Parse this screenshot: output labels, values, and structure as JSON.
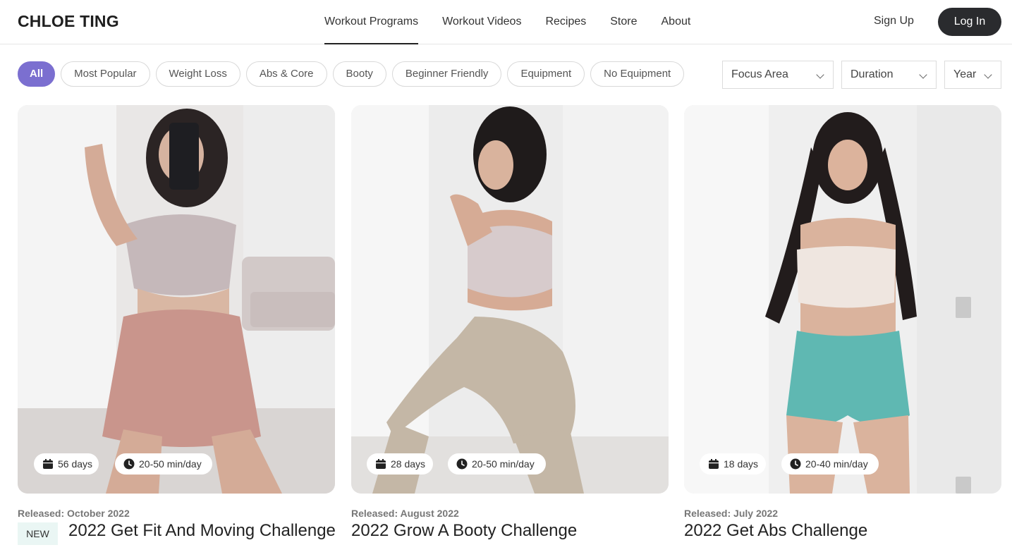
{
  "header": {
    "logo": "CHLOE TING",
    "nav": [
      {
        "label": "Workout Programs",
        "active": true
      },
      {
        "label": "Workout Videos",
        "active": false
      },
      {
        "label": "Recipes",
        "active": false
      },
      {
        "label": "Store",
        "active": false
      },
      {
        "label": "About",
        "active": false
      }
    ],
    "signup_label": "Sign Up",
    "login_label": "Log In"
  },
  "filters": {
    "pills": [
      "All",
      "Most Popular",
      "Weight Loss",
      "Abs & Core",
      "Booty",
      "Beginner Friendly",
      "Equipment",
      "No Equipment"
    ],
    "active_pill": "All",
    "dropdowns": [
      "Focus Area",
      "Duration",
      "Year"
    ]
  },
  "cards": [
    {
      "days": "56 days",
      "duration": "20-50 min/day",
      "released": "Released: October 2022",
      "new_tag": "NEW",
      "title": "2022 Get Fit And Moving Challenge"
    },
    {
      "days": "28 days",
      "duration": "20-50 min/day",
      "released": "Released: August 2022",
      "title": "2022 Grow A Booty Challenge"
    },
    {
      "days": "18 days",
      "duration": "20-40 min/day",
      "released": "Released: July 2022",
      "title": "2022 Get Abs Challenge"
    }
  ],
  "colors": {
    "accent": "#7b6fd0",
    "login_bg": "#2a2b2e",
    "new_tag_bg": "#eaf6f4"
  }
}
